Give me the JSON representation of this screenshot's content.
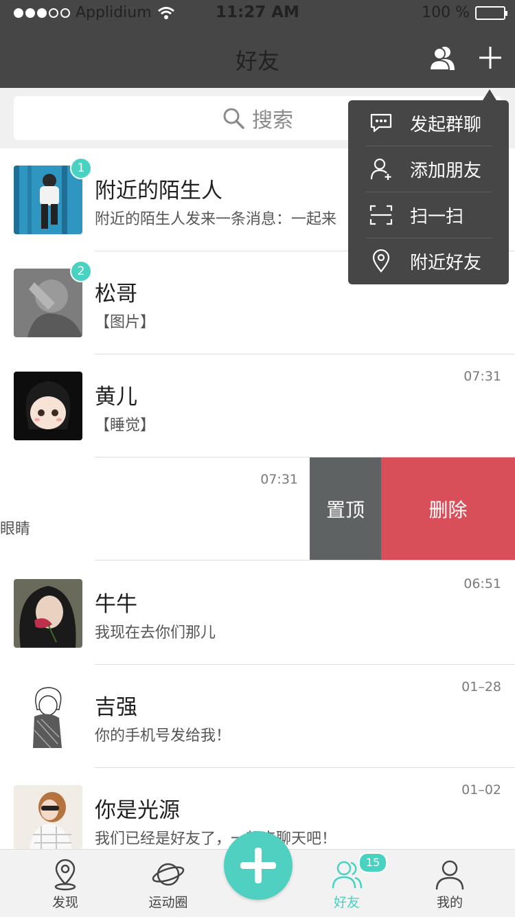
{
  "status_bar": {
    "carrier": "Applidium",
    "time": "11:27 AM",
    "battery": "100 %"
  },
  "header": {
    "title": "好友"
  },
  "search": {
    "placeholder": "搜索"
  },
  "rows": [
    {
      "name": "附近的陌生人",
      "message": "附近的陌生人发来一条消息：一起来",
      "time": "",
      "badge": "1"
    },
    {
      "name": "松哥",
      "message": "【图片】",
      "time": "",
      "badge": "2"
    },
    {
      "name": "黄儿",
      "message": "【睡觉】",
      "time": "07:31"
    },
    {
      "name": "",
      "message": "眼睛",
      "time": "07:31"
    },
    {
      "name": "牛牛",
      "message": "我现在去你们那儿",
      "time": "06:51"
    },
    {
      "name": "吉强",
      "message": "你的手机号发给我！",
      "time": "01–28"
    },
    {
      "name": "你是光源",
      "message": "我们已经是好友了，一起来聊天吧！",
      "time": "01–02"
    }
  ],
  "swipe_actions": {
    "pin": "置顶",
    "delete": "删除"
  },
  "menu": {
    "items": [
      {
        "label": "发起群聊",
        "icon": "chat-bubble-icon"
      },
      {
        "label": "添加朋友",
        "icon": "add-user-icon"
      },
      {
        "label": "扫一扫",
        "icon": "scan-icon"
      },
      {
        "label": "附近好友",
        "icon": "location-pin-icon"
      }
    ]
  },
  "tabbar": {
    "tabs": [
      {
        "label": "发现",
        "icon": "location-pin-icon"
      },
      {
        "label": "运动圈",
        "icon": "planet-icon"
      },
      {
        "label": "好友",
        "icon": "friends-icon",
        "badge": "15",
        "active": true
      },
      {
        "label": "我的",
        "icon": "person-icon"
      }
    ]
  },
  "colors": {
    "header_bg": "#464646",
    "accent": "#47d2c1",
    "delete": "#d94f59",
    "pin": "#5f6262"
  }
}
